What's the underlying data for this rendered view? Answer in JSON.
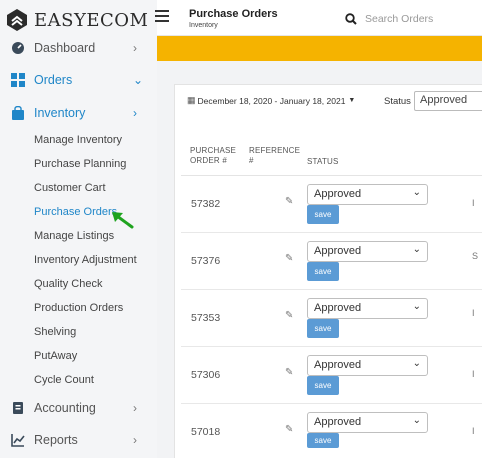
{
  "brand": {
    "name": "EASYECOM"
  },
  "header": {
    "title": "Purchase Orders",
    "subtitle": "Inventory",
    "search_placeholder": "Search Orders"
  },
  "nav": [
    {
      "label": "Dashboard",
      "chevron": "›",
      "icon": "dashboard-icon"
    },
    {
      "label": "Orders",
      "chevron": "⌄",
      "icon": "grid-icon"
    },
    {
      "label": "Inventory",
      "chevron": "›",
      "icon": "bag-icon"
    },
    {
      "label": "Accounting",
      "chevron": "›",
      "icon": "ledger-icon"
    },
    {
      "label": "Reports",
      "chevron": "›",
      "icon": "chart-icon"
    }
  ],
  "inventory_sub": [
    "Manage Inventory",
    "Purchase Planning",
    "Customer Cart",
    "Purchase Orders",
    "Manage Listings",
    "Inventory Adjustment",
    "Quality Check",
    "Production Orders",
    "Shelving",
    "PutAway",
    "Cycle Count"
  ],
  "filters": {
    "date_range": "December 18, 2020 - January 18, 2021",
    "status_label": "Status",
    "status_value": "Approved"
  },
  "table": {
    "col_po": [
      "PURCHASE",
      "ORDER #"
    ],
    "col_ref": [
      "REFERENCE",
      "#"
    ],
    "col_status": "STATUS",
    "rows": [
      {
        "po": "57382",
        "status": "Approved",
        "save": "save"
      },
      {
        "po": "57376",
        "status": "Approved",
        "save": "save"
      },
      {
        "po": "57353",
        "status": "Approved",
        "save": "save"
      },
      {
        "po": "57306",
        "status": "Approved",
        "save": "save"
      },
      {
        "po": "57018",
        "status": "Approved",
        "save": "save"
      }
    ]
  },
  "colors": {
    "accent": "#1f86c8",
    "banner": "#f5b300",
    "save": "#5b9bd5",
    "arrow": "#1fa31f"
  }
}
